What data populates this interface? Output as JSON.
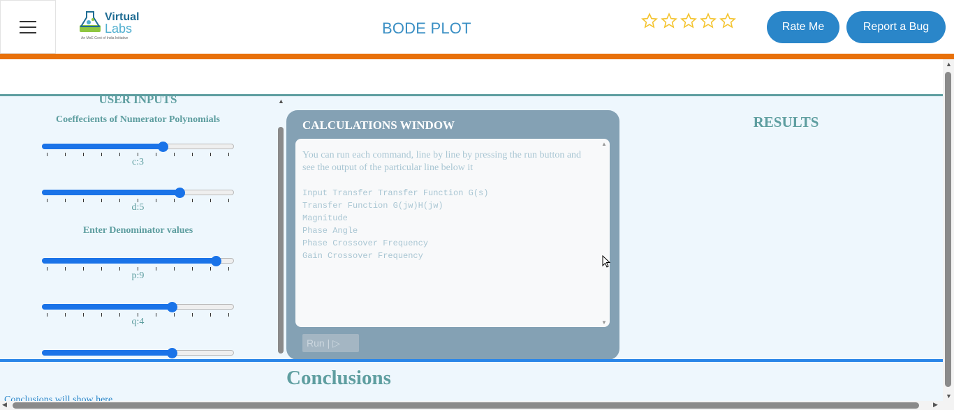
{
  "header": {
    "logo": {
      "line1": "Virtual",
      "line2": "Labs",
      "tagline": "An MoE Govt of India Initiative"
    },
    "title": "BODE PLOT",
    "rating": {
      "stars": 5,
      "filled": 0,
      "star_color": "#f4c430"
    },
    "rate_button": "Rate Me",
    "bug_button": "Report a Bug"
  },
  "inputs": {
    "title": "USER INPUTS",
    "numerator_heading": "Coeffecients of Numerator Polynomials",
    "denominator_heading": "Enter Denominator values",
    "sliders": [
      {
        "label": "c:3",
        "fraction": 0.64
      },
      {
        "label": "d:5",
        "fraction": 0.73
      },
      {
        "label": "p:9",
        "fraction": 0.93
      },
      {
        "label": "q:4",
        "fraction": 0.69
      },
      {
        "label": "",
        "fraction": 0.69
      }
    ]
  },
  "calculations": {
    "title": "CALCULATIONS WINDOW",
    "note": "You can run each command, line by line by pressing the run button and see the output of the particular line below it",
    "commands": [
      "Input Transfer Transfer Function G(s)",
      "Transfer Function G(jw)H(jw)",
      "Magnitude",
      "Phase Angle",
      "Phase Crossover Frequency",
      "Gain Crossover Frequency"
    ],
    "run_button": "Run | ▷"
  },
  "results": {
    "title": "RESULTS"
  },
  "conclusions": {
    "title": "Conclusions",
    "text": "Conclusions will show here"
  },
  "colors": {
    "accent_orange": "#e8700a",
    "teal": "#5e9ea0",
    "button_blue": "#2a86c9",
    "slider_blue": "#1a73e8",
    "calc_panel": "#84a1b4"
  }
}
